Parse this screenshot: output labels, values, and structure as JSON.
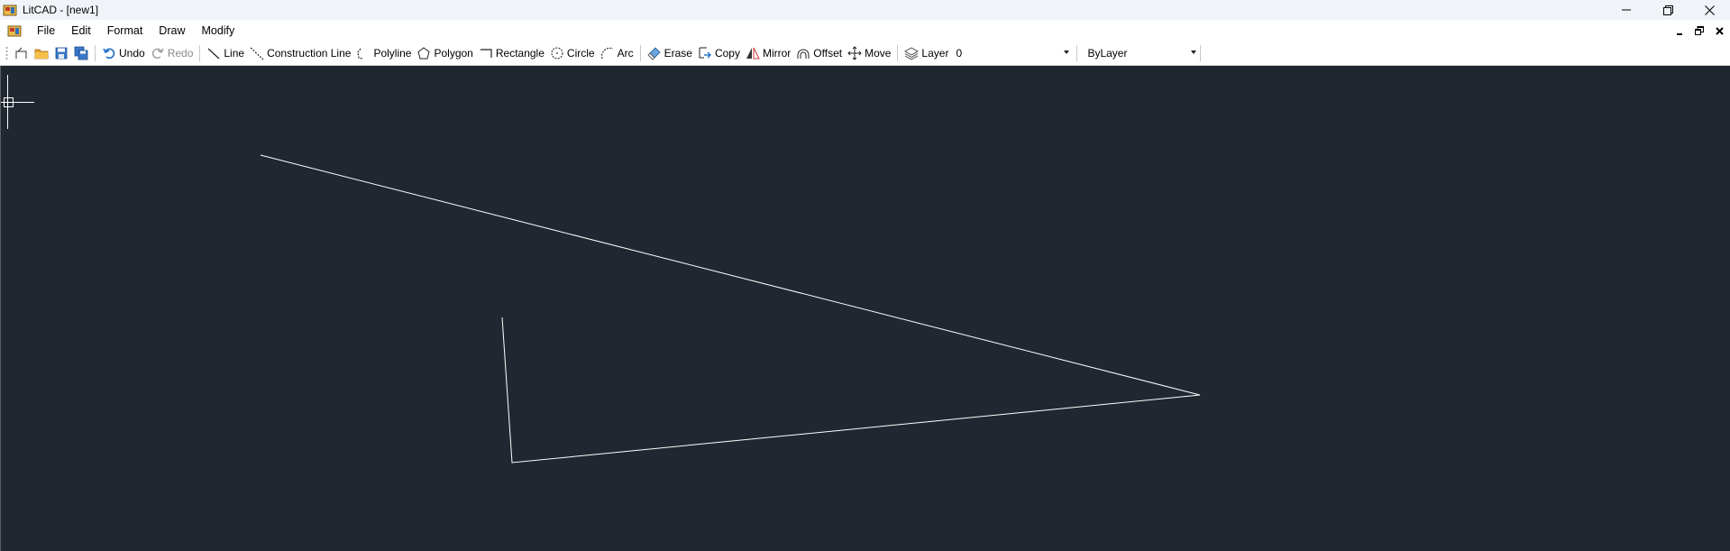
{
  "window": {
    "title": "LitCAD - [new1]",
    "icons": {
      "app": "litcad-app-icon",
      "minimize": "minimize-icon",
      "maximize": "maximize-icon",
      "close": "close-icon"
    }
  },
  "menubar": {
    "items": [
      "File",
      "Edit",
      "Format",
      "Draw",
      "Modify"
    ]
  },
  "toolbar": {
    "undo": "Undo",
    "redo": "Redo",
    "line": "Line",
    "construction_line": "Construction Line",
    "polyline": "Polyline",
    "polygon": "Polygon",
    "rectangle": "Rectangle",
    "circle": "Circle",
    "arc": "Arc",
    "erase": "Erase",
    "copy": "Copy",
    "mirror": "Mirror",
    "offset": "Offset",
    "move": "Move",
    "layer_label": "Layer",
    "layer_value": "0",
    "color_value": "ByLayer"
  },
  "colors": {
    "canvas_background": "#212730",
    "entity_stroke": "#ffffff",
    "cursor": "#ffffff"
  }
}
